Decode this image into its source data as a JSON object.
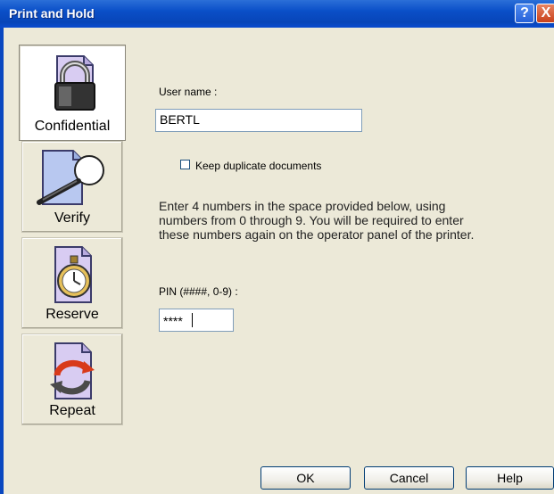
{
  "window": {
    "title": "Print and Hold",
    "help_glyph": "?",
    "close_glyph": "X"
  },
  "sidebar": {
    "items": [
      {
        "label": "Confidential",
        "icon": "padlock-icon",
        "selected": true
      },
      {
        "label": "Verify",
        "icon": "magnifier-icon",
        "selected": false
      },
      {
        "label": "Reserve",
        "icon": "stopwatch-icon",
        "selected": false
      },
      {
        "label": "Repeat",
        "icon": "repeat-arrows-icon",
        "selected": false
      }
    ]
  },
  "form": {
    "user_name_label": "User name :",
    "user_name_value": "BERTL",
    "keep_duplicates_label": "Keep duplicate documents",
    "keep_duplicates_checked": false,
    "instructions_lines": [
      "Enter 4 numbers in the space provided below, using",
      "numbers from 0 through 9. You will be required to enter",
      "these numbers again on the operator panel of the printer."
    ],
    "pin_label": "PIN (####, 0-9) :",
    "pin_value": "****"
  },
  "buttons": {
    "ok": "OK",
    "cancel": "Cancel",
    "help": "Help"
  },
  "colors": {
    "titlebar": "#0a4fc8",
    "dialog_bg": "#ece9d8",
    "close_button": "#d65a2e"
  }
}
